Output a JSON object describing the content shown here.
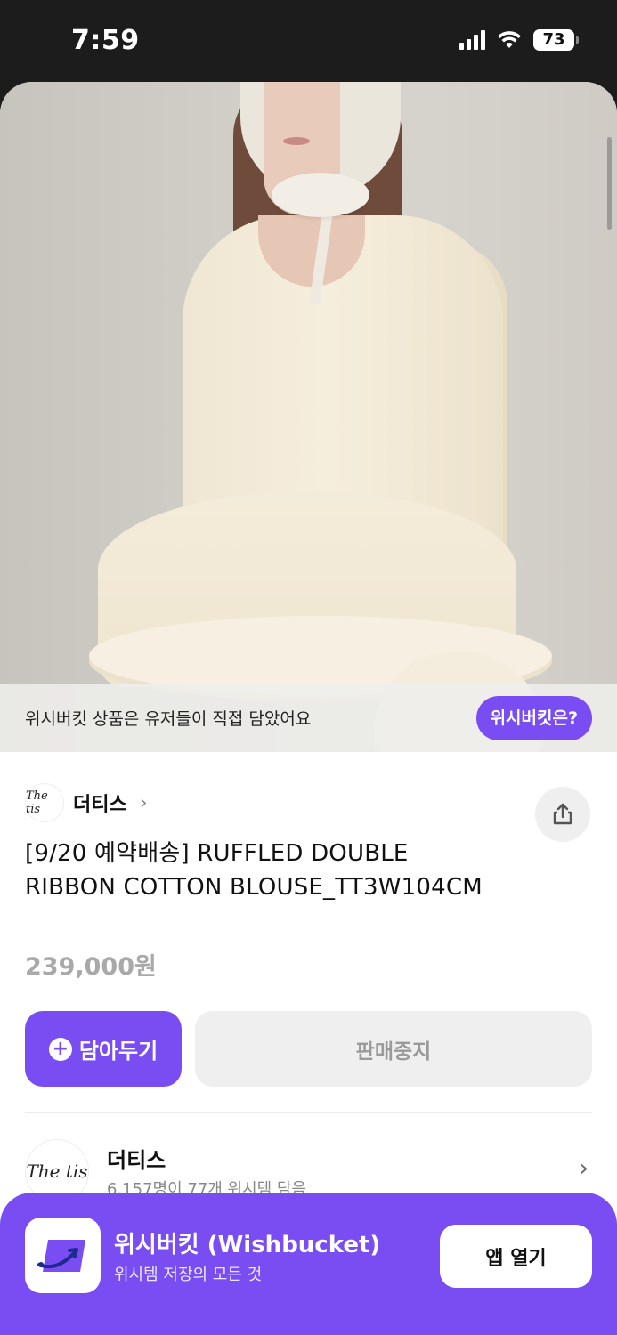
{
  "status_bar": {
    "time": "7:59",
    "battery": "73"
  },
  "hero": {
    "banner_text": "위시버킷 상품은 유저들이 직접 담았어요",
    "banner_button": "위시버킷은?"
  },
  "product": {
    "brand_name": "더티스",
    "brand_logo_text": "The tis",
    "title": "[9/20 예약배송] RUFFLED DOUBLE RIBBON COTTON BLOUSE_TT3W104CM",
    "price": "239,000원"
  },
  "actions": {
    "save_label": "담아두기",
    "sold_out_label": "판매중지"
  },
  "brand_card": {
    "name": "더티스",
    "stats": "6,157명이 77개 위시템 담음"
  },
  "app_banner": {
    "name": "위시버킷 (Wishbucket)",
    "tagline": "위시템 저장의 모든 것",
    "open_button": "앱 열기"
  },
  "colors": {
    "accent": "#7a4df3",
    "status_bar_bg": "#1c1c1c",
    "price_gray": "#a9a9a9"
  },
  "icons": [
    "signal-icon",
    "wifi-icon",
    "battery-icon",
    "chevron-right-icon",
    "share-icon",
    "plus-icon",
    "wishbucket-app-icon"
  ]
}
